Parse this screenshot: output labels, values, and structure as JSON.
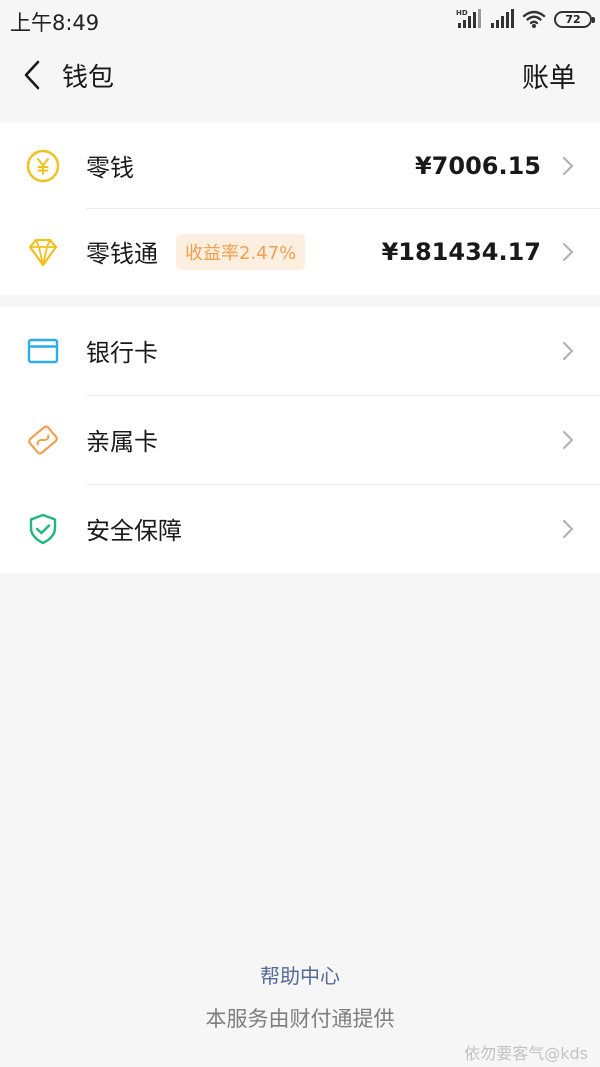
{
  "status_bar": {
    "time": "上午8:49",
    "hd_label": "HD",
    "battery_level": "72"
  },
  "nav": {
    "title": "钱包",
    "bill_label": "账单"
  },
  "balance_group": [
    {
      "label": "零钱",
      "value": "¥7006.15",
      "icon": "yuan-coin-icon"
    },
    {
      "label": "零钱通",
      "badge": "收益率2.47%",
      "value": "¥181434.17",
      "icon": "diamond-icon"
    }
  ],
  "service_group": [
    {
      "label": "银行卡",
      "icon": "bank-card-icon"
    },
    {
      "label": "亲属卡",
      "icon": "family-card-icon"
    },
    {
      "label": "安全保障",
      "icon": "shield-check-icon"
    }
  ],
  "footer": {
    "help_label": "帮助中心",
    "provider_note": "本服务由财付通提供",
    "watermark": "依勿要客气@kds"
  },
  "colors": {
    "background": "#f6f6f6",
    "coin_yellow": "#f2c01d",
    "bank_blue": "#2aaeea",
    "family_orange": "#f0a04f",
    "shield_green": "#21b77a",
    "link_blue": "#576b95"
  }
}
